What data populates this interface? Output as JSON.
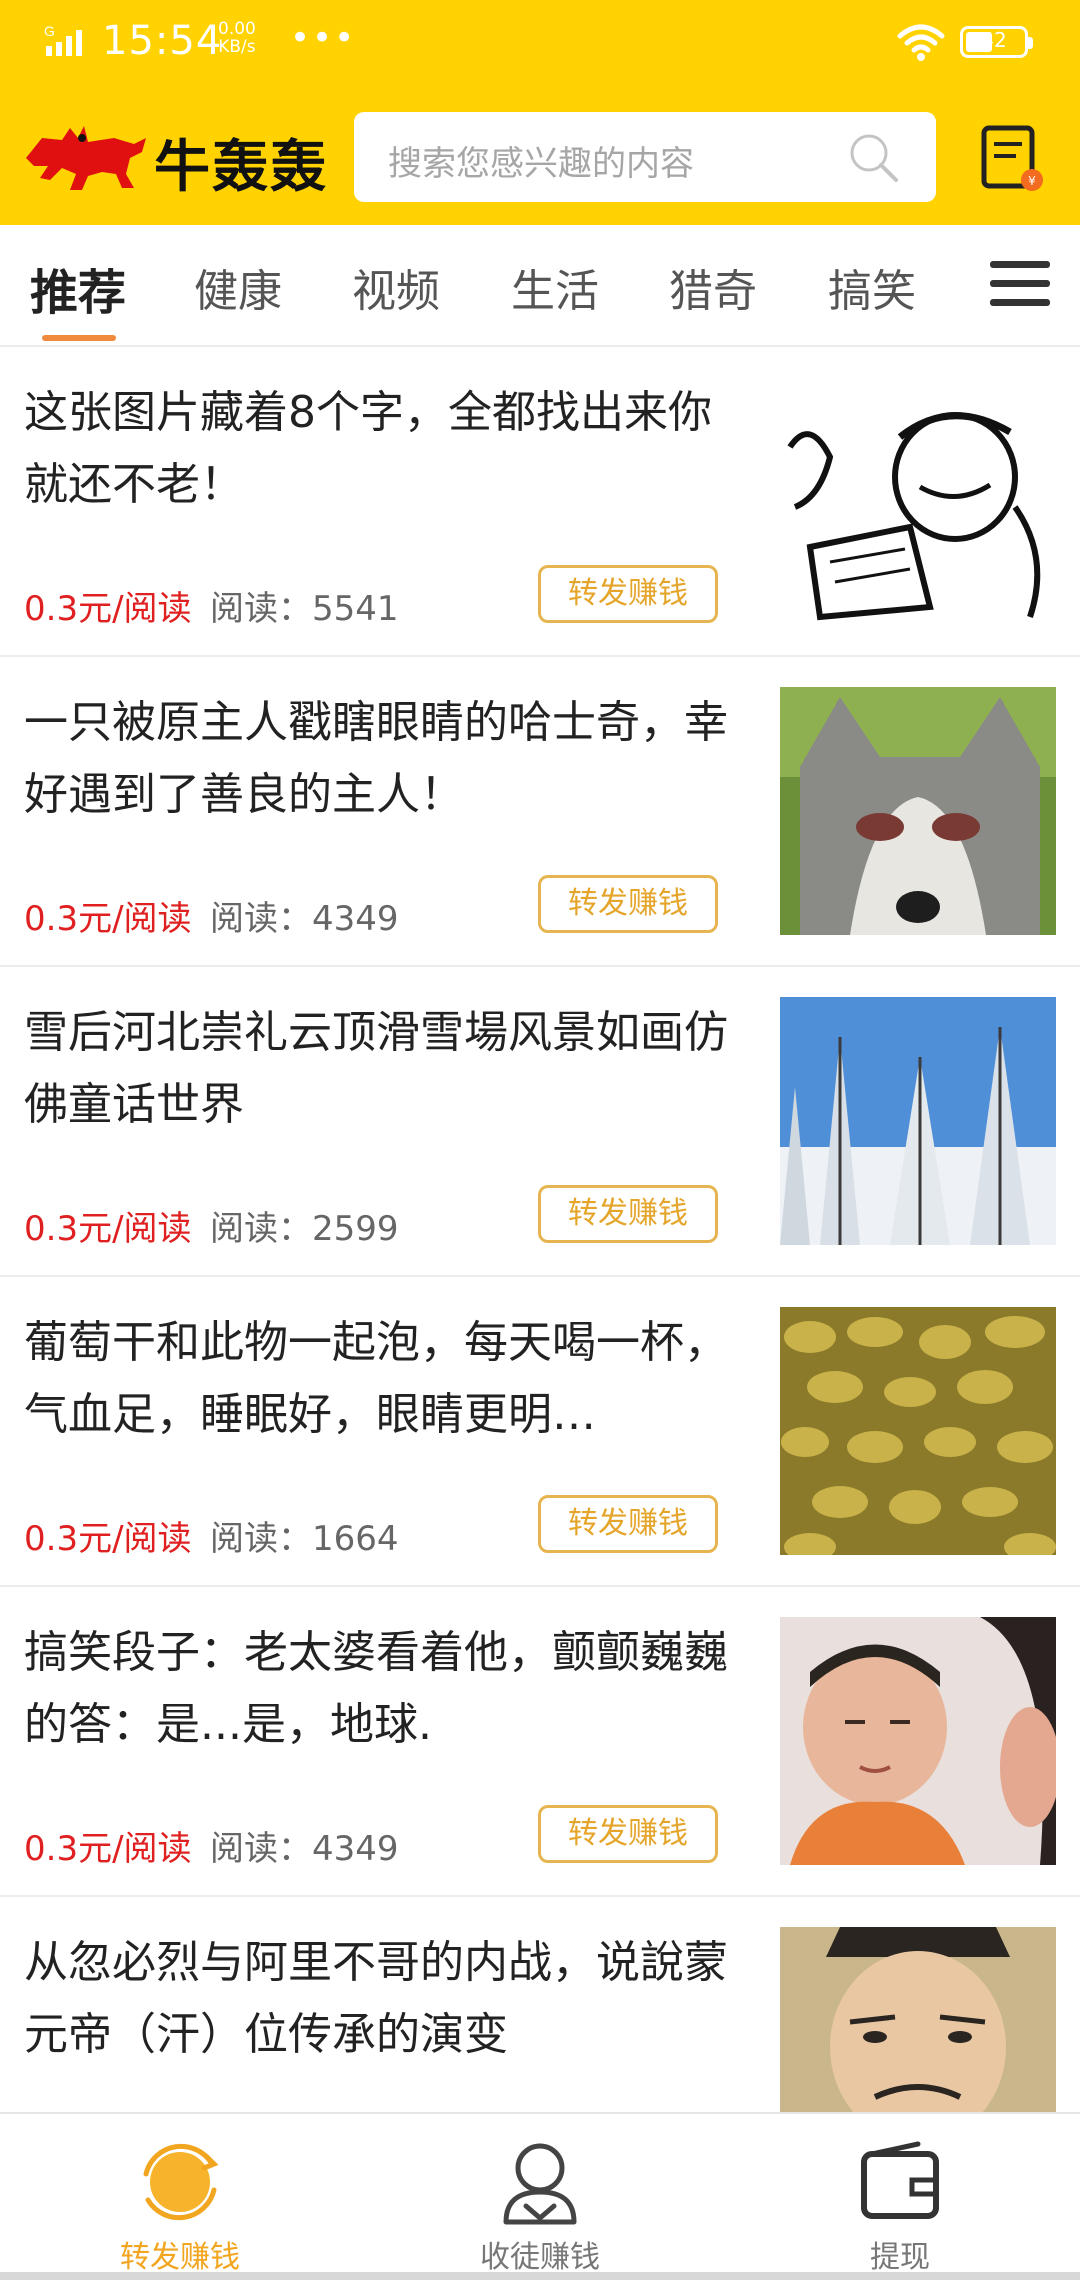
{
  "status_bar": {
    "time": "15:54",
    "speed_value": "0.00",
    "speed_unit": "KB/s",
    "more": "•••",
    "battery": "42"
  },
  "header": {
    "app_name": "牛轰轰",
    "search_placeholder": "搜索您感兴趣的内容"
  },
  "tabs": [
    {
      "label": "推荐",
      "active": true
    },
    {
      "label": "健康"
    },
    {
      "label": "视频"
    },
    {
      "label": "生活"
    },
    {
      "label": "猎奇"
    },
    {
      "label": "搞笑"
    }
  ],
  "feed": [
    {
      "title": "这张图片藏着8个字，全都找出来你就还不老！",
      "price": "0.3元/阅读",
      "reads": "阅读：5541",
      "share": "转发赚钱"
    },
    {
      "title": "一只被原主人戳瞎眼睛的哈士奇，幸好遇到了善良的主人！",
      "price": "0.3元/阅读",
      "reads": "阅读：4349",
      "share": "转发赚钱"
    },
    {
      "title": "雪后河北崇礼云顶滑雪場风景如画仿佛童话世界",
      "price": "0.3元/阅读",
      "reads": "阅读：2599",
      "share": "转发赚钱"
    },
    {
      "title": "葡萄干和此物一起泡，每天喝一杯，气血足，睡眠好，眼睛更明…",
      "price": "0.3元/阅读",
      "reads": "阅读：1664",
      "share": "转发赚钱"
    },
    {
      "title": "搞笑段子：老太婆看着他，颤颤巍巍的答：是...是，地球.",
      "price": "0.3元/阅读",
      "reads": "阅读：4349",
      "share": "转发赚钱"
    },
    {
      "title": "从忽必烈与阿里不哥的内战，说說蒙元帝（汗）位传承的演变"
    }
  ],
  "bottom_nav": [
    {
      "label": "转发赚钱",
      "active": true
    },
    {
      "label": "收徒赚钱"
    },
    {
      "label": "提现"
    }
  ],
  "colors": {
    "brand_yellow": "#ffd200",
    "price_red": "#e02020",
    "share_orange": "#e4a52a",
    "tab_underline": "#f08a3c"
  }
}
